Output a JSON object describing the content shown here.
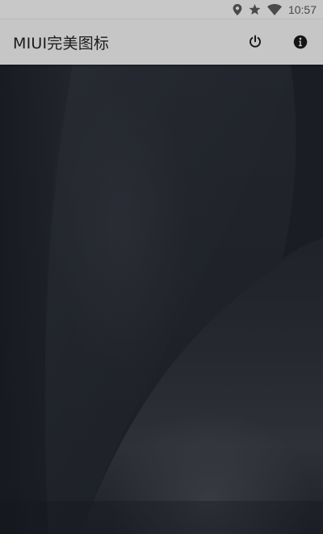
{
  "status_bar": {
    "time": "10:57",
    "icons": [
      "location-icon",
      "star-icon",
      "wifi-icon"
    ]
  },
  "app_bar": {
    "title": "MIUI完美图标",
    "actions": [
      "power-icon",
      "info-icon"
    ]
  },
  "colors": {
    "status_bar_bg": "#c8c8c9",
    "app_bar_bg": "#c6c6c7",
    "wallpaper_base": "#1e2128"
  }
}
